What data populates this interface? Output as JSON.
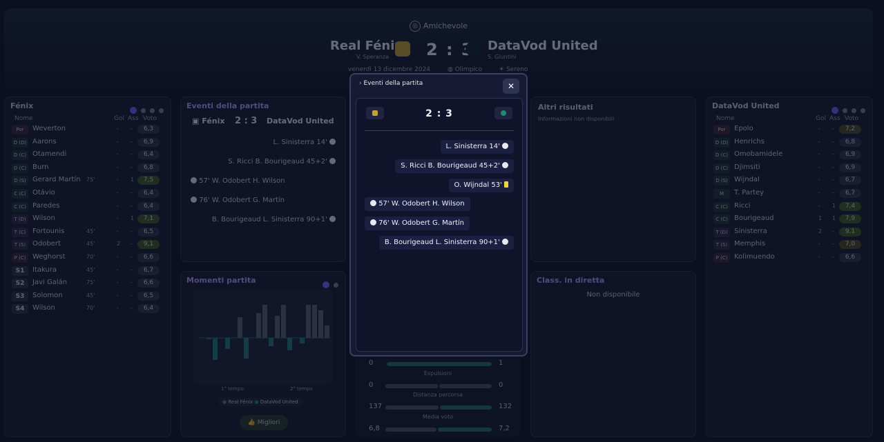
{
  "header": {
    "competition": "Amichevole",
    "home": {
      "name": "Real Fénix",
      "coach": "V. Speranza"
    },
    "away": {
      "name": "DataVod United",
      "coach": "S. Giuntini"
    },
    "score": "2 : 3",
    "date": "venerdì 13 dicembre 2024",
    "stadium": "Olimpico",
    "weather": "Sereno"
  },
  "home_panel": {
    "title": "Fénix",
    "cols": {
      "name": "Nome",
      "gol": "Gol",
      "ass": "Ass",
      "voto": "Voto"
    },
    "players": [
      {
        "pos": "Por",
        "name": "Weverton",
        "sub": "",
        "gol": "-",
        "ass": "-",
        "vote": "6,3",
        "c": ""
      },
      {
        "pos": "D (D)",
        "name": "Aarons",
        "sub": "",
        "gol": "-",
        "ass": "-",
        "vote": "6,9",
        "c": ""
      },
      {
        "pos": "D (C)",
        "name": "Otamendi",
        "sub": "",
        "gol": "-",
        "ass": "-",
        "vote": "6,4",
        "c": ""
      },
      {
        "pos": "D (C)",
        "name": "Burn",
        "sub": "",
        "gol": "-",
        "ass": "-",
        "vote": "6,8",
        "c": ""
      },
      {
        "pos": "D (S)",
        "name": "Gerard Martín",
        "sub": "75'",
        "gol": "-",
        "ass": "1",
        "vote": "7,5",
        "c": "g"
      },
      {
        "pos": "C (C)",
        "name": "Otávio",
        "sub": "",
        "gol": "-",
        "ass": "-",
        "vote": "6,4",
        "c": ""
      },
      {
        "pos": "C (C)",
        "name": "Paredes",
        "sub": "",
        "gol": "-",
        "ass": "-",
        "vote": "6,4",
        "c": ""
      },
      {
        "pos": "T (D)",
        "name": "Wilson",
        "sub": "",
        "gol": "-",
        "ass": "1",
        "vote": "7,1",
        "c": "g"
      },
      {
        "pos": "T (C)",
        "name": "Fortounis",
        "sub": "45'",
        "gol": "-",
        "ass": "-",
        "vote": "6,5",
        "c": ""
      },
      {
        "pos": "T (S)",
        "name": "Odobert",
        "sub": "45'",
        "gol": "2",
        "ass": "-",
        "vote": "9,1",
        "c": "g"
      },
      {
        "pos": "P (C)",
        "name": "Weghorst",
        "sub": "70'",
        "gol": "-",
        "ass": "-",
        "vote": "6,6",
        "c": ""
      },
      {
        "pos": "S1",
        "name": "Itakura",
        "sub": "45'",
        "gol": "-",
        "ass": "-",
        "vote": "6,7",
        "c": ""
      },
      {
        "pos": "S2",
        "name": "Javi Galán",
        "sub": "75'",
        "gol": "-",
        "ass": "-",
        "vote": "6,6",
        "c": ""
      },
      {
        "pos": "S3",
        "name": "Solomon",
        "sub": "45'",
        "gol": "-",
        "ass": "-",
        "vote": "6,5",
        "c": ""
      },
      {
        "pos": "S4",
        "name": "Wilson",
        "sub": "70'",
        "gol": "-",
        "ass": "-",
        "vote": "6,4",
        "c": ""
      }
    ]
  },
  "away_panel": {
    "title": "DataVod United",
    "cols": {
      "name": "Nome",
      "gol": "Gol",
      "ass": "Ass",
      "voto": "Voto"
    },
    "players": [
      {
        "pos": "Por",
        "name": "Epolo",
        "gol": "-",
        "ass": "-",
        "vote": "7,2",
        "c": "y"
      },
      {
        "pos": "D (D)",
        "name": "Henrichs",
        "gol": "-",
        "ass": "-",
        "vote": "6,8",
        "c": ""
      },
      {
        "pos": "D (C)",
        "name": "Omobamidele",
        "gol": "-",
        "ass": "-",
        "vote": "6,9",
        "c": ""
      },
      {
        "pos": "D (C)",
        "name": "Djimsiti",
        "gol": "-",
        "ass": "-",
        "vote": "6,9",
        "c": ""
      },
      {
        "pos": "D (S)",
        "name": "Wijndal",
        "gol": "-",
        "ass": "-",
        "vote": "6,7",
        "c": ""
      },
      {
        "pos": "M",
        "name": "T. Partey",
        "gol": "-",
        "ass": "-",
        "vote": "6,7",
        "c": ""
      },
      {
        "pos": "C (C)",
        "name": "Ricci",
        "gol": "-",
        "ass": "1",
        "vote": "7,4",
        "c": "g"
      },
      {
        "pos": "C (C)",
        "name": "Bourigeaud",
        "gol": "1",
        "ass": "1",
        "vote": "7,9",
        "c": "g"
      },
      {
        "pos": "T (D)",
        "name": "Sinisterra",
        "gol": "2",
        "ass": "-",
        "vote": "9,1",
        "c": "g"
      },
      {
        "pos": "T (S)",
        "name": "Memphis",
        "gol": "-",
        "ass": "-",
        "vote": "7,0",
        "c": "y"
      },
      {
        "pos": "P (C)",
        "name": "Kolimuendo",
        "gol": "-",
        "ass": "-",
        "vote": "6,6",
        "c": ""
      }
    ]
  },
  "events_panel": {
    "title": "Eventi della partita",
    "home": "Fénix",
    "away": "DataVod United",
    "score": "2 : 3",
    "events": [
      {
        "side": "away",
        "text": "L. Sinisterra 14'"
      },
      {
        "side": "away",
        "text": "S. Ricci  B. Bourigeaud 45+2'"
      },
      {
        "side": "home",
        "text": "57'  W. Odobert  H. Wilson"
      },
      {
        "side": "home",
        "text": "76'  W. Odobert  G. Martín"
      },
      {
        "side": "away",
        "text": "B. Bourigeaud  L. Sinisterra 90+1'"
      }
    ]
  },
  "moments": {
    "title": "Momenti partita",
    "first_half": "1° tempo",
    "second_half": "2° tempo",
    "legend_home": "Real Fénix",
    "legend_away": "DataVod United",
    "button": "Migliori"
  },
  "other_results": {
    "title": "Altri risultati",
    "text": "Informazioni non disponibili"
  },
  "live_table": {
    "title": "Class. in diretta",
    "text": "Non disponibile"
  },
  "stats": [
    {
      "label": "",
      "home": "0",
      "away": "1"
    },
    {
      "label": "Espulsioni",
      "home": "0",
      "away": "0"
    },
    {
      "label": "Distanza percorsa",
      "home": "137",
      "away": "132"
    },
    {
      "label": "Media voto",
      "home": "6,8",
      "away": "7,2"
    }
  ],
  "modal": {
    "title": "Eventi della partita",
    "score": "2 : 3",
    "events": [
      {
        "side": "away",
        "text": "L. Sinisterra 14'",
        "icon": "ball"
      },
      {
        "side": "away",
        "text": "S. Ricci  B. Bourigeaud 45+2'",
        "icon": "ball"
      },
      {
        "side": "away",
        "text": "O. Wijndal 53'",
        "icon": "yellow"
      },
      {
        "side": "home",
        "text": "57'  W. Odobert  H. Wilson",
        "icon": "ball"
      },
      {
        "side": "home",
        "text": "76'  W. Odobert  G. Martín",
        "icon": "ball"
      },
      {
        "side": "away",
        "text": "B. Bourigeaud  L. Sinisterra 90+1'",
        "icon": "ball"
      }
    ]
  }
}
